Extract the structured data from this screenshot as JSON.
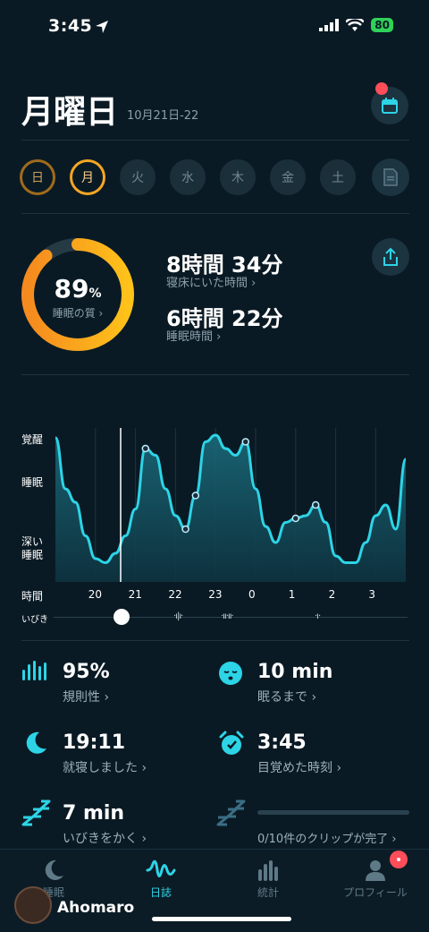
{
  "status": {
    "time": "3:45",
    "battery": "80"
  },
  "header": {
    "title": "月曜日",
    "date_range": "10月21日-22"
  },
  "week": {
    "days": [
      {
        "label": "日",
        "state": "done"
      },
      {
        "label": "月",
        "state": "active"
      },
      {
        "label": "火",
        "state": "none"
      },
      {
        "label": "水",
        "state": "none"
      },
      {
        "label": "木",
        "state": "none"
      },
      {
        "label": "金",
        "state": "none"
      },
      {
        "label": "土",
        "state": "none"
      }
    ]
  },
  "summary": {
    "quality_value": "89",
    "quality_unit": "%",
    "quality_label": "睡眠の質 ›",
    "quality_fraction": 0.89,
    "time_in_bed": "8時間 34分",
    "time_in_bed_label": "寝床にいた時間 ›",
    "sleep_time": "6時間 22分",
    "sleep_time_label": "睡眠時間 ›"
  },
  "chart_data": {
    "type": "area",
    "y_categories": [
      "覚醒",
      "睡眠",
      "深い睡眠"
    ],
    "x_axis_label": "時間",
    "x_ticks": [
      "20",
      "21",
      "22",
      "23",
      "0",
      "1",
      "2",
      "3"
    ],
    "x": [
      19.0,
      19.25,
      19.5,
      19.75,
      20.0,
      20.25,
      20.5,
      20.75,
      21.0,
      21.25,
      21.5,
      21.75,
      22.0,
      22.25,
      22.5,
      22.75,
      23.0,
      23.25,
      23.5,
      23.75,
      0.0,
      0.25,
      0.5,
      0.75,
      1.0,
      1.25,
      1.5,
      1.75,
      2.0,
      2.25,
      2.5,
      2.75,
      3.0,
      3.25,
      3.5,
      3.75
    ],
    "y": [
      0.98,
      0.6,
      0.5,
      0.25,
      0.08,
      0.05,
      0.12,
      0.25,
      0.45,
      0.9,
      0.85,
      0.6,
      0.4,
      0.3,
      0.55,
      0.95,
      1.0,
      0.9,
      0.85,
      0.95,
      0.6,
      0.32,
      0.2,
      0.35,
      0.38,
      0.4,
      0.48,
      0.35,
      0.1,
      0.05,
      0.05,
      0.2,
      0.4,
      0.48,
      0.3,
      0.82
    ],
    "snore_label": "いびき"
  },
  "metrics": [
    {
      "icon": "bars-icon",
      "value": "95%",
      "label": "規則性 ›"
    },
    {
      "icon": "sleepy-face-icon",
      "value": "10 min",
      "label": "眠るまで ›"
    },
    {
      "icon": "moon-icon",
      "value": "19:11",
      "label": "就寝しました ›"
    },
    {
      "icon": "alarm-icon",
      "value": "3:45",
      "label": "目覚めた時刻 ›"
    },
    {
      "icon": "zzz-icon",
      "value": "7 min",
      "label": "いびきをかく ›"
    },
    {
      "icon": "zzz-icon",
      "value": "",
      "label": "0/10件のクリップが完了 ›"
    }
  ],
  "tabs": [
    {
      "label": "睡眠",
      "icon": "moon-icon"
    },
    {
      "label": "日誌",
      "icon": "wave-icon"
    },
    {
      "label": "統計",
      "icon": "chart-icon"
    },
    {
      "label": "プロフィール",
      "icon": "person-icon"
    }
  ],
  "watermark": {
    "text": "Ahomaro"
  },
  "colors": {
    "accent": "#2dd4e6",
    "orange": "#f5a623",
    "background": "#0a1a24"
  }
}
